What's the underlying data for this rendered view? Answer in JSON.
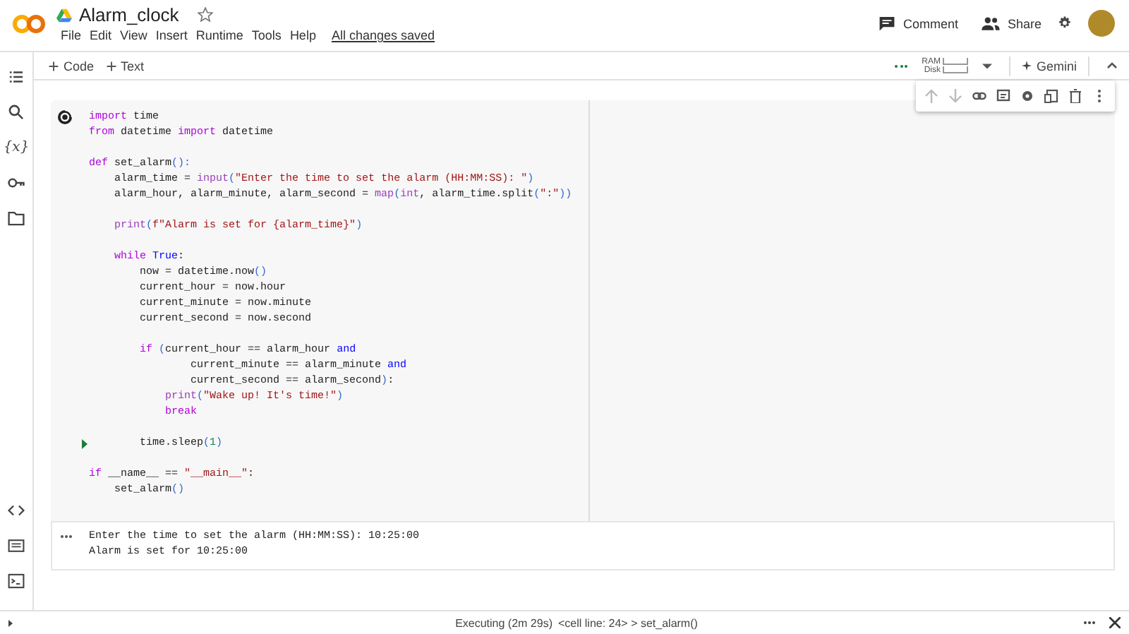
{
  "header": {
    "notebook_title": "Alarm_clock",
    "starred": false,
    "menu": [
      "File",
      "Edit",
      "View",
      "Insert",
      "Runtime",
      "Tools",
      "Help"
    ],
    "save_status": "All changes saved",
    "actions": [
      {
        "kind": "comment",
        "label": "Comment"
      },
      {
        "kind": "share",
        "label": "Share"
      }
    ]
  },
  "toolbar": {
    "add_buttons": [
      {
        "label": "Code"
      },
      {
        "label": "Text"
      }
    ],
    "ram_label": "RAM",
    "disk_label": "Disk",
    "gemini_label": "Gemini"
  },
  "sidebar": {
    "top": [
      {
        "kind": "toc"
      },
      {
        "kind": "search"
      },
      {
        "kind": "variables",
        "glyph": "{x}"
      },
      {
        "kind": "key"
      },
      {
        "kind": "folder"
      }
    ],
    "bottom": [
      {
        "kind": "code"
      },
      {
        "kind": "panel"
      },
      {
        "kind": "terminal"
      }
    ]
  },
  "cell": {
    "running": true,
    "lines": [
      {
        "executing": false,
        "gap_before": false,
        "tokens": [
          {
            "kind": "kw",
            "t": "import"
          },
          {
            "kind": "plain",
            "t": " time"
          }
        ]
      },
      {
        "executing": false,
        "gap_before": false,
        "tokens": [
          {
            "kind": "kw",
            "t": "from"
          },
          {
            "kind": "plain",
            "t": " datetime "
          },
          {
            "kind": "kw",
            "t": "import"
          },
          {
            "kind": "plain",
            "t": " datetime"
          }
        ]
      },
      {
        "executing": false,
        "gap_before": true,
        "tokens": [
          {
            "kind": "kw",
            "t": "def"
          },
          {
            "kind": "plain",
            "t": " set_alarm"
          },
          {
            "kind": "paren",
            "t": "():"
          }
        ]
      },
      {
        "executing": false,
        "gap_before": false,
        "tokens": [
          {
            "kind": "plain",
            "t": "    alarm_time = "
          },
          {
            "kind": "builtin",
            "t": "input"
          },
          {
            "kind": "paren",
            "t": "("
          },
          {
            "kind": "str",
            "t": "\"Enter the time to set the alarm (HH:MM:SS): \""
          },
          {
            "kind": "paren",
            "t": ")"
          }
        ]
      },
      {
        "executing": false,
        "gap_before": false,
        "tokens": [
          {
            "kind": "plain",
            "t": "    alarm_hour, alarm_minute, alarm_second = "
          },
          {
            "kind": "builtin",
            "t": "map"
          },
          {
            "kind": "paren",
            "t": "("
          },
          {
            "kind": "builtin",
            "t": "int"
          },
          {
            "kind": "plain",
            "t": ", alarm_time.split"
          },
          {
            "kind": "paren",
            "t": "("
          },
          {
            "kind": "str",
            "t": "\":\""
          },
          {
            "kind": "paren",
            "t": "))"
          }
        ]
      },
      {
        "executing": false,
        "gap_before": true,
        "tokens": [
          {
            "kind": "builtin",
            "t": "    print"
          },
          {
            "kind": "paren",
            "t": "("
          },
          {
            "kind": "str",
            "t": "f\"Alarm is set for {alarm_time}\""
          },
          {
            "kind": "paren",
            "t": ")"
          }
        ]
      },
      {
        "executing": false,
        "gap_before": true,
        "tokens": [
          {
            "kind": "kw",
            "t": "    while"
          },
          {
            "kind": "const",
            "t": " True"
          },
          {
            "kind": "plain",
            "t": ":"
          }
        ]
      },
      {
        "executing": false,
        "gap_before": false,
        "tokens": [
          {
            "kind": "plain",
            "t": "        now = datetime.now"
          },
          {
            "kind": "paren",
            "t": "()"
          }
        ]
      },
      {
        "executing": false,
        "gap_before": false,
        "tokens": [
          {
            "kind": "plain",
            "t": "        current_hour = now.hour"
          }
        ]
      },
      {
        "executing": false,
        "gap_before": false,
        "tokens": [
          {
            "kind": "plain",
            "t": "        current_minute = now.minute"
          }
        ]
      },
      {
        "executing": false,
        "gap_before": false,
        "tokens": [
          {
            "kind": "plain",
            "t": "        current_second = now.second"
          }
        ]
      },
      {
        "executing": false,
        "gap_before": true,
        "tokens": [
          {
            "kind": "kw",
            "t": "        if"
          },
          {
            "kind": "paren",
            "t": " ("
          },
          {
            "kind": "plain",
            "t": "current_hour == alarm_hour "
          },
          {
            "kind": "const",
            "t": "and"
          }
        ]
      },
      {
        "executing": false,
        "gap_before": false,
        "tokens": [
          {
            "kind": "plain",
            "t": "                current_minute == alarm_minute "
          },
          {
            "kind": "const",
            "t": "and"
          }
        ]
      },
      {
        "executing": false,
        "gap_before": false,
        "tokens": [
          {
            "kind": "plain",
            "t": "                current_second == alarm_second"
          },
          {
            "kind": "paren",
            "t": ")"
          },
          {
            "kind": "plain",
            "t": ":"
          }
        ]
      },
      {
        "executing": false,
        "gap_before": false,
        "tokens": [
          {
            "kind": "builtin",
            "t": "            print"
          },
          {
            "kind": "paren",
            "t": "("
          },
          {
            "kind": "str",
            "t": "\"Wake up! It's time!\""
          },
          {
            "kind": "paren",
            "t": ")"
          }
        ]
      },
      {
        "executing": false,
        "gap_before": false,
        "tokens": [
          {
            "kind": "kw",
            "t": "            break"
          }
        ]
      },
      {
        "executing": true,
        "gap_before": true,
        "tokens": [
          {
            "kind": "plain",
            "t": "        time.sleep"
          },
          {
            "kind": "paren",
            "t": "("
          },
          {
            "kind": "num",
            "t": "1"
          },
          {
            "kind": "paren",
            "t": ")"
          }
        ]
      },
      {
        "executing": false,
        "gap_before": true,
        "tokens": [
          {
            "kind": "kw",
            "t": "if"
          },
          {
            "kind": "plain",
            "t": " __name__ == "
          },
          {
            "kind": "str",
            "t": "\"__main__\""
          },
          {
            "kind": "plain",
            "t": ":"
          }
        ]
      },
      {
        "executing": false,
        "gap_before": false,
        "tokens": [
          {
            "kind": "plain",
            "t": "    set_alarm"
          },
          {
            "kind": "paren",
            "t": "()"
          }
        ]
      }
    ],
    "output": [
      "Enter the time to set the alarm (HH:MM:SS): 10:25:00",
      "Alarm is set for 10:25:00"
    ]
  },
  "status_bar": {
    "state": "Executing (2m 29s)",
    "trace": "<cell line: 24> > set_alarm()"
  }
}
